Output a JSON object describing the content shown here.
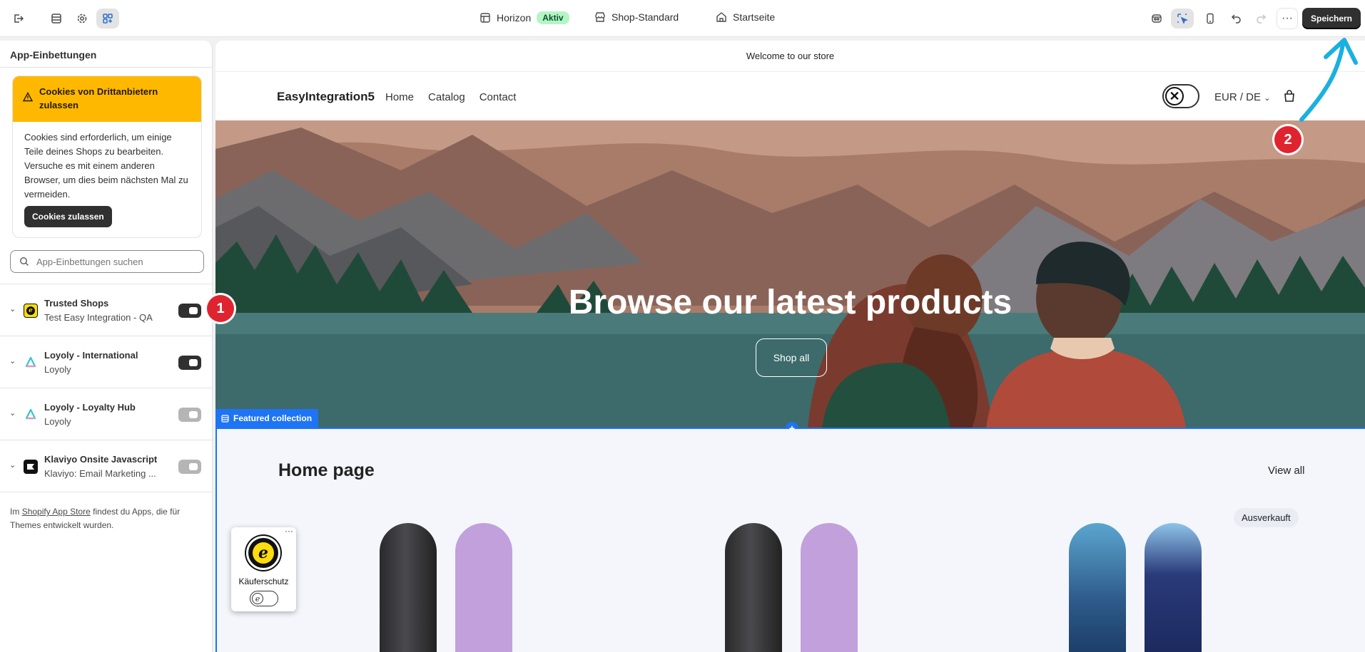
{
  "topbar": {
    "theme_name": "Horizon",
    "theme_status": "Aktiv",
    "store_label": "Shop-Standard",
    "page_label": "Startseite",
    "save_label": "Speichern"
  },
  "sidebar": {
    "title": "App-Einbettungen",
    "warning": {
      "title": "Cookies von Drittanbietern zulassen",
      "body": "Cookies sind erforderlich, um einige Teile deines Shops zu bearbeiten. Versuche es mit einem anderen Browser, um dies beim nächsten Mal zu vermeiden.",
      "button": "Cookies zulassen"
    },
    "search_placeholder": "App-Einbettungen suchen",
    "apps": [
      {
        "name": "Trusted Shops",
        "sub": "Test Easy Integration - QA",
        "enabled": true,
        "logo": "trusted-shops-logo"
      },
      {
        "name": "Loyoly - International",
        "sub": "Loyoly",
        "enabled": true,
        "logo": "loyoly-logo"
      },
      {
        "name": "Loyoly - Loyalty Hub",
        "sub": "Loyoly",
        "enabled": false,
        "logo": "loyoly-logo"
      },
      {
        "name": "Klaviyo Onsite Javascript",
        "sub": "Klaviyo: Email Marketing ...",
        "enabled": false,
        "logo": "klaviyo-logo"
      }
    ],
    "footer_prefix": "Im",
    "footer_link": "Shopify App Store",
    "footer_suffix": "findest du Apps, die für Themes entwickelt wurden."
  },
  "preview": {
    "announcement": "Welcome to our store",
    "brand": "EasyIntegration5",
    "nav": [
      "Home",
      "Catalog",
      "Contact"
    ],
    "currency": "EUR / DE",
    "hero_title": "Browse our latest products",
    "hero_button": "Shop all",
    "section_tag": "Featured collection",
    "collection_title": "Home page",
    "view_all": "View all",
    "sold_out": "Ausverkauft",
    "badge_label": "Käuferschutz",
    "badge_more": "···"
  },
  "markers": [
    "1",
    "2"
  ],
  "colors": {
    "accent_blue": "#1d74f5",
    "warning_yellow": "#ffb800",
    "marker_red": "#e0242f",
    "arrow_cyan": "#1ab0e0"
  }
}
